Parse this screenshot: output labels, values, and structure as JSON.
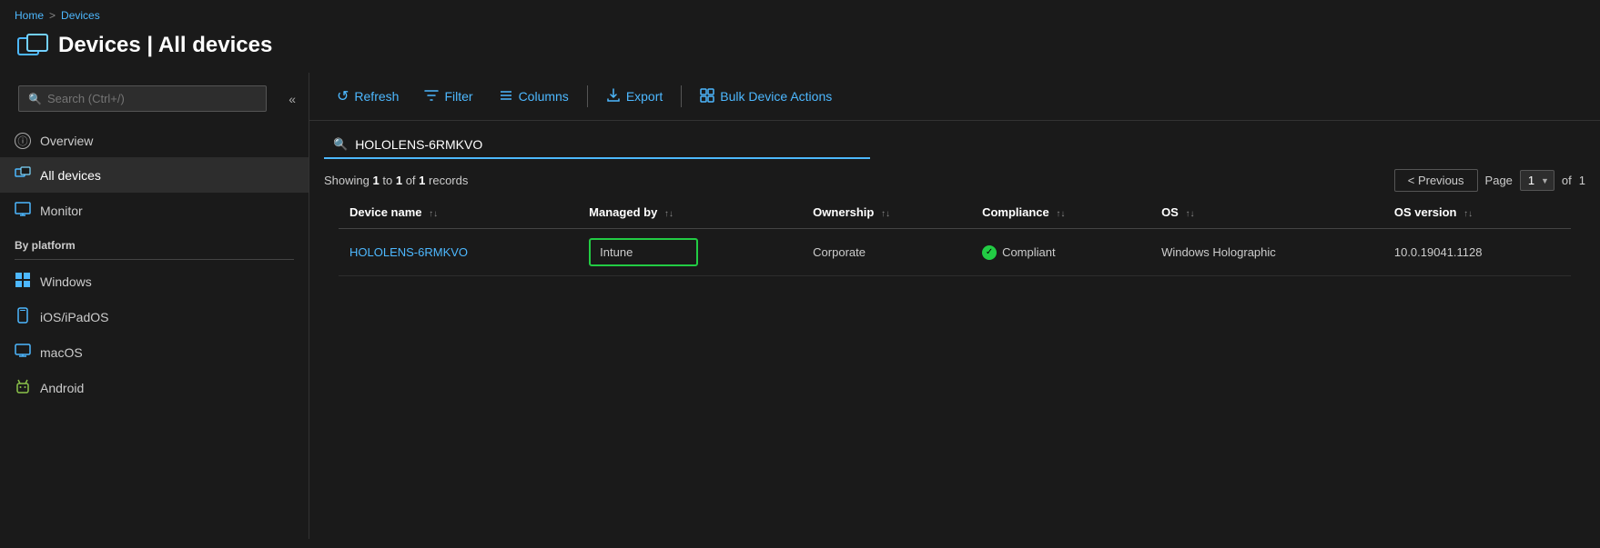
{
  "breadcrumb": {
    "home_label": "Home",
    "separator": ">",
    "current": "Devices"
  },
  "page_header": {
    "title": "Devices | All devices"
  },
  "sidebar": {
    "search_placeholder": "Search (Ctrl+/)",
    "nav_items": [
      {
        "id": "overview",
        "label": "Overview",
        "icon": "info-icon"
      },
      {
        "id": "all-devices",
        "label": "All devices",
        "icon": "devices-icon",
        "active": true
      },
      {
        "id": "monitor",
        "label": "Monitor",
        "icon": "monitor-icon"
      }
    ],
    "by_platform_label": "By platform",
    "platform_items": [
      {
        "id": "windows",
        "label": "Windows",
        "icon": "windows-icon"
      },
      {
        "id": "ios",
        "label": "iOS/iPadOS",
        "icon": "ios-icon"
      },
      {
        "id": "macos",
        "label": "macOS",
        "icon": "macos-icon"
      },
      {
        "id": "android",
        "label": "Android",
        "icon": "android-icon"
      }
    ]
  },
  "toolbar": {
    "refresh_label": "Refresh",
    "filter_label": "Filter",
    "columns_label": "Columns",
    "export_label": "Export",
    "bulk_actions_label": "Bulk Device Actions"
  },
  "filter_bar": {
    "search_value": "HOLOLENS-6RMKVO",
    "search_placeholder": ""
  },
  "records": {
    "showing_text": "Showing",
    "from": "1",
    "to": "1",
    "of_label": "of",
    "total": "1",
    "records_label": "records"
  },
  "pagination": {
    "previous_label": "< Previous",
    "page_label": "Page",
    "current_page": "1",
    "of_label": "of",
    "total_pages": "1"
  },
  "table": {
    "columns": [
      {
        "id": "device-name",
        "label": "Device name",
        "sortable": true
      },
      {
        "id": "managed-by",
        "label": "Managed by",
        "sortable": true
      },
      {
        "id": "ownership",
        "label": "Ownership",
        "sortable": true
      },
      {
        "id": "compliance",
        "label": "Compliance",
        "sortable": true
      },
      {
        "id": "os",
        "label": "OS",
        "sortable": true
      },
      {
        "id": "os-version",
        "label": "OS version",
        "sortable": true
      }
    ],
    "rows": [
      {
        "device_name": "HOLOLENS-6RMKVO",
        "managed_by": "Intune",
        "ownership": "Corporate",
        "compliance": "Compliant",
        "os": "Windows Holographic",
        "os_version": "10.0.19041.1128"
      }
    ]
  },
  "icons": {
    "sort_asc": "↑",
    "sort_desc": "↓",
    "search": "🔍",
    "refresh": "↺",
    "filter": "⧖",
    "columns": "≡",
    "export": "⬇",
    "bulk": "⧉",
    "check": "✓",
    "chevron_down": "▼",
    "info": "ⓘ",
    "collapse": "«"
  },
  "colors": {
    "accent": "#4db8ff",
    "bg_primary": "#1a1a1a",
    "bg_secondary": "#2d2d2d",
    "active_item": "#2d2d2d",
    "border": "#444",
    "managed_by_highlight": "#22cc44",
    "text_primary": "#ffffff",
    "text_secondary": "#cccccc",
    "text_muted": "#888888"
  }
}
